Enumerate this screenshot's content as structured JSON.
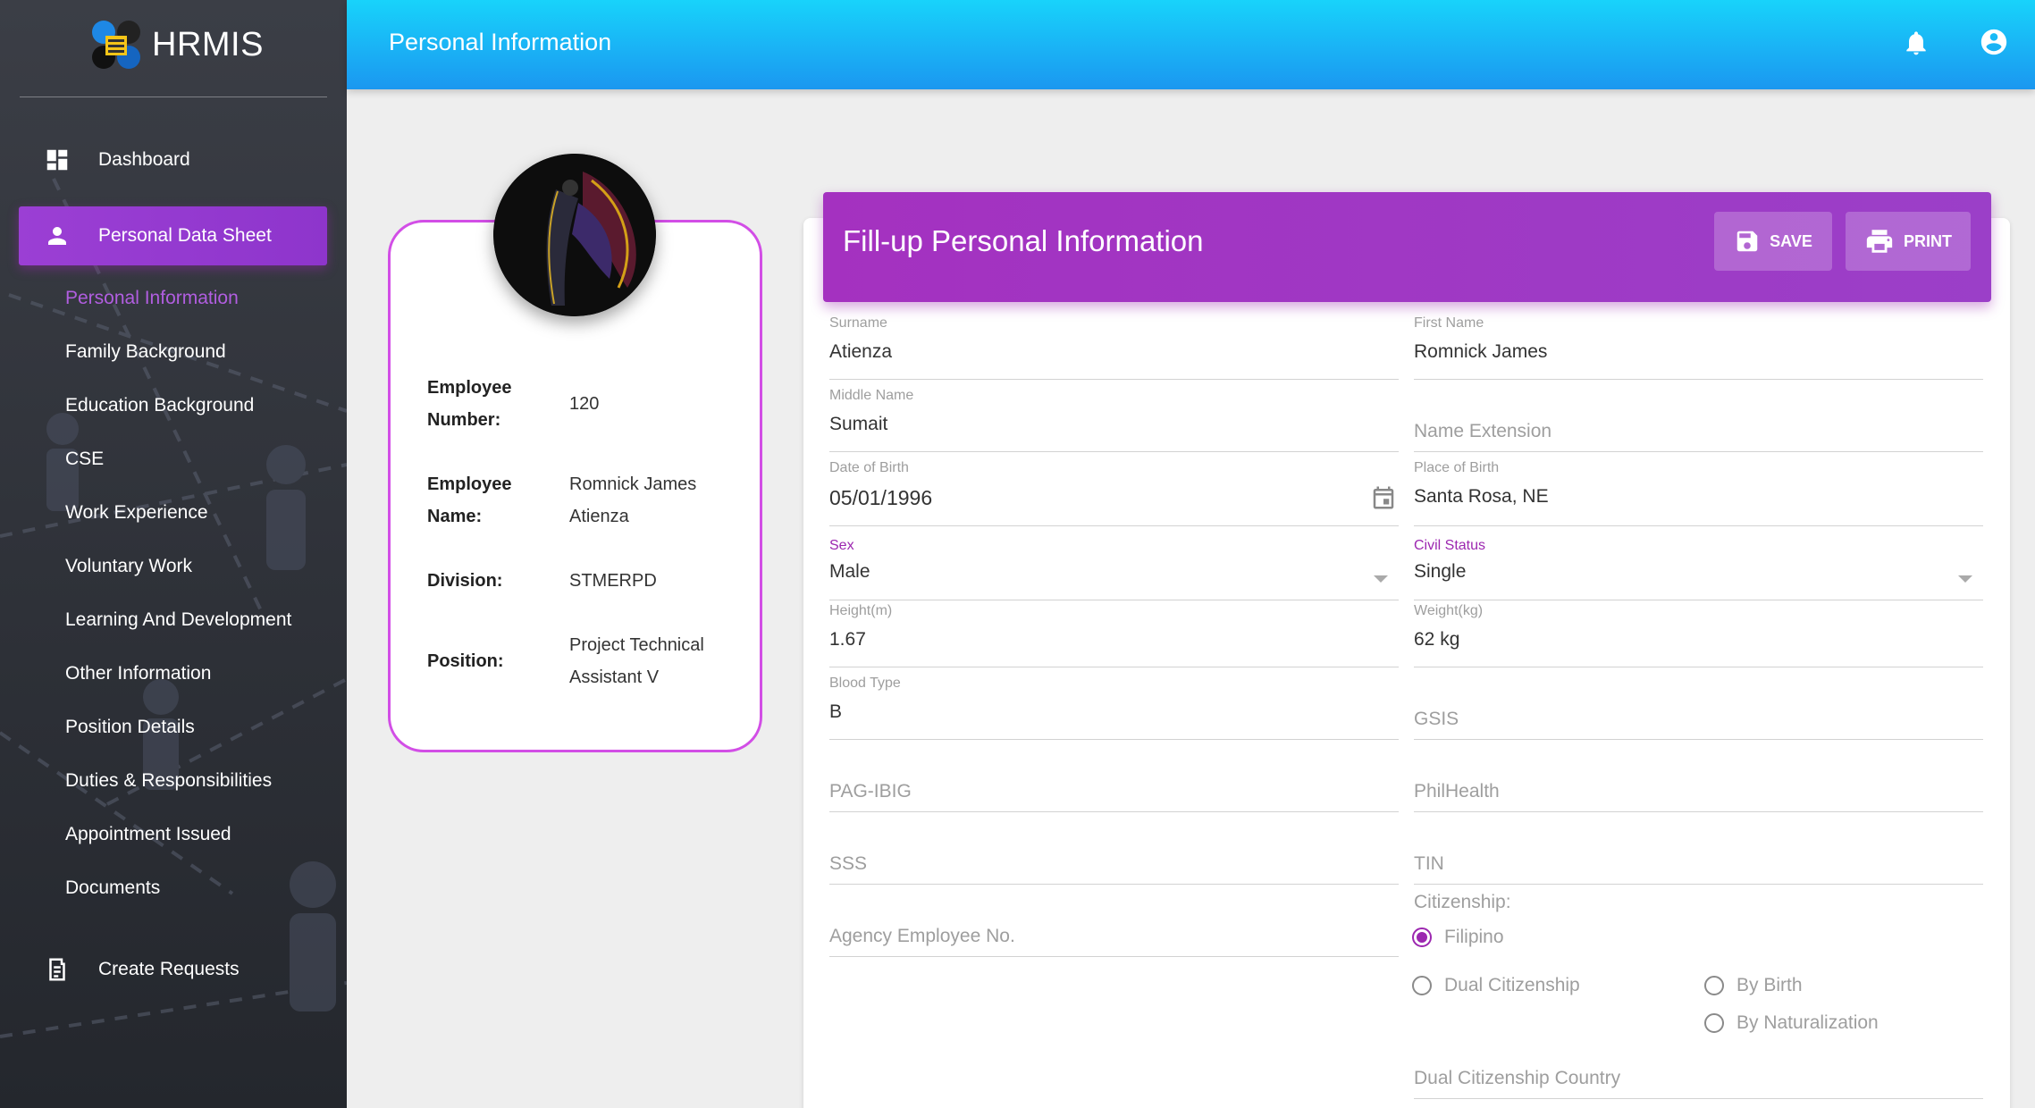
{
  "brand": {
    "name": "HRMIS"
  },
  "header": {
    "title": "Personal Information"
  },
  "sidebar": {
    "main": [
      {
        "label": "Dashboard",
        "icon": "dashboard-icon"
      },
      {
        "label": "Personal Data Sheet",
        "icon": "person-icon",
        "active": true
      },
      {
        "label": "Create Requests",
        "icon": "document-request-icon"
      }
    ],
    "sub": [
      {
        "label": "Personal Information",
        "active": true
      },
      {
        "label": "Family Background"
      },
      {
        "label": "Education Background"
      },
      {
        "label": "CSE"
      },
      {
        "label": "Work Experience"
      },
      {
        "label": "Voluntary Work"
      },
      {
        "label": "Learning And Development"
      },
      {
        "label": "Other Information"
      },
      {
        "label": "Position Details"
      },
      {
        "label": "Duties & Responsibilities"
      },
      {
        "label": "Appointment Issued"
      },
      {
        "label": "Documents"
      }
    ]
  },
  "profile": {
    "employee_number_label_1": "Employee",
    "employee_number_label_2": "Number:",
    "employee_number": "120",
    "employee_name_label_1": "Employee",
    "employee_name_label_2": "Name:",
    "employee_name_1": "Romnick James",
    "employee_name_2": "Atienza",
    "division_label": "Division:",
    "division": "STMERPD",
    "position_label": "Position:",
    "position_1": "Project Technical",
    "position_2": "Assistant V"
  },
  "form": {
    "title": "Fill-up Personal Information",
    "save_label": "SAVE",
    "print_label": "PRINT",
    "surname_label": "Surname",
    "surname": "Atienza",
    "first_name_label": "First Name",
    "first_name": "Romnick James",
    "middle_name_label": "Middle Name",
    "middle_name": "Sumait",
    "name_extension_placeholder": "Name Extension",
    "dob_label": "Date of Birth",
    "dob": "05/01/1996",
    "pob_label": "Place of Birth",
    "pob": "Santa Rosa, NE",
    "sex_label": "Sex",
    "sex": "Male",
    "civil_status_label": "Civil Status",
    "civil_status": "Single",
    "height_label": "Height(m)",
    "height": "1.67",
    "weight_label": "Weight(kg)",
    "weight": "62 kg",
    "blood_type_label": "Blood Type",
    "blood_type": "B",
    "gsis_placeholder": "GSIS",
    "pagibig_placeholder": "PAG-IBIG",
    "philhealth_placeholder": "PhilHealth",
    "sss_placeholder": "SSS",
    "tin_placeholder": "TIN",
    "agency_no_placeholder": "Agency Employee No.",
    "citizenship_label": "Citizenship:",
    "citizenship_options": {
      "filipino": "Filipino",
      "dual": "Dual Citizenship",
      "by_birth": "By Birth",
      "by_naturalization": "By Naturalization"
    },
    "citizenship_selected": "Filipino",
    "dual_country_placeholder": "Dual Citizenship Country"
  },
  "colors": {
    "accent": "#9c27b0",
    "header_top": "#18d3fb",
    "header_bottom": "#1b97f0",
    "sidebar": "#2e3138"
  }
}
